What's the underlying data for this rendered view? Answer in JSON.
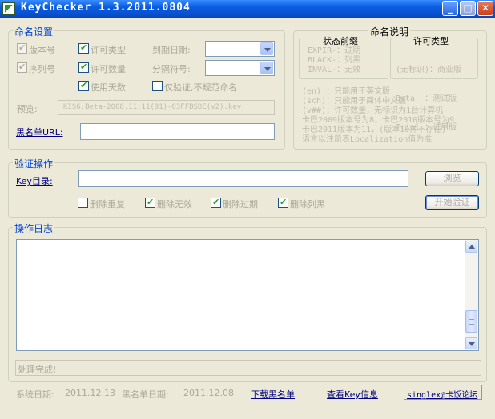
{
  "window": {
    "title": "KeyChecker 1.3.2011.0804"
  },
  "naming": {
    "legend": "命名设置",
    "version_no": "版本号",
    "serial_no": "序列号",
    "license_type": "许可类型",
    "license_qty": "许可数量",
    "use_days": "使用天数",
    "expiry_date": "到期日期:",
    "separator": "分隔符号:",
    "verify_only": "仅验证,不规范命名",
    "preview_label": "预览:",
    "preview_value": "KIS6.Beta-2008.11.11(91)-03FFBSDE(v2).key",
    "blacklist_url_label": "黑名单URL:",
    "blacklist_url_value": ""
  },
  "naming_help": {
    "legend": "命名说明",
    "status_title": "状态前缀",
    "status_lines": [
      "EXPIR-：过期",
      "BLACK-：列黑",
      "INVAL-：无效"
    ],
    "type_title": "许可类型",
    "type_lines": [
      "(无标识)：商业版",
      "Beta  ：测试版",
      "Trial ：试用版"
    ],
    "notes": [
      "(en) ：只能用于英文版",
      "(sch)：只能用于简体中文版",
      "(v##)：许可数量，无标识为1台计算机",
      "卡巴2009版本号为8，卡巴2010版本号为9",
      "卡巴2011版本为11，(版本10并不存在)",
      "语言以注册表Localization值为准"
    ]
  },
  "verify": {
    "legend": "验证操作",
    "key_dir_label": "Key目录:",
    "key_dir_value": "",
    "browse_label": "浏览",
    "start_label": "开始验证",
    "del_dup": "删除重复",
    "del_invalid": "删除无效",
    "del_expired": "删除过期",
    "del_black": "删除列黑"
  },
  "log": {
    "legend": "操作日志",
    "content": "",
    "status": "处理完成!"
  },
  "footer": {
    "sys_date_label": "系统日期:",
    "sys_date": "2011.12.13",
    "bl_date_label": "黑名单日期:",
    "bl_date": "2011.12.08",
    "download_link": "下载黑名单",
    "view_key_link": "查看Key信息",
    "forum_button": "singlex@卡饭论坛"
  },
  "checkboxes": {
    "version_no": true,
    "serial_no": true,
    "license_type": true,
    "license_qty": true,
    "use_days": true,
    "verify_only": false,
    "del_dup": false,
    "del_invalid": true,
    "del_expired": true,
    "del_black": true
  },
  "icons": {
    "app": "keychecker-app-icon",
    "minimize": "minimize-icon",
    "maximize": "maximize-icon",
    "close": "close-icon"
  },
  "colors": {
    "title_bar": "#0a5ce0",
    "group_legend": "#0046d5",
    "window_bg": "#ece9d8",
    "checkmark": "#21a121"
  }
}
